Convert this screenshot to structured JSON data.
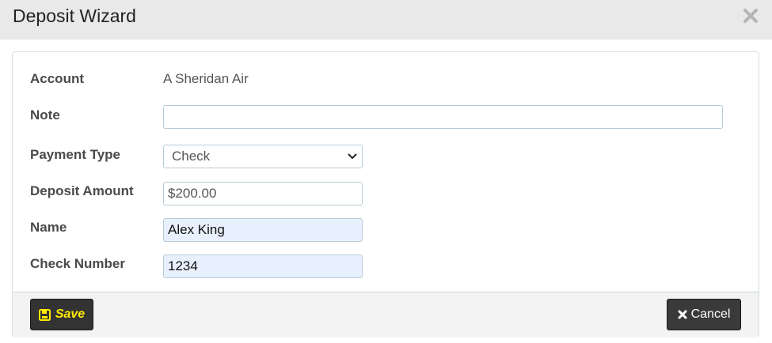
{
  "modal": {
    "title": "Deposit Wizard",
    "close_icon": "close-icon"
  },
  "form": {
    "account_label": "Account",
    "account_value": "A Sheridan Air",
    "note_label": "Note",
    "note_value": "",
    "payment_type_label": "Payment Type",
    "payment_type_value": "Check",
    "deposit_amount_label": "Deposit Amount",
    "deposit_amount_value": "$200.00",
    "name_label": "Name",
    "name_value": "Alex King",
    "check_number_label": "Check Number",
    "check_number_value": "1234"
  },
  "footer": {
    "save_label": "Save",
    "save_icon": "floppy-disk-icon",
    "cancel_label": "Cancel",
    "cancel_icon": "close-icon"
  },
  "colors": {
    "header_bg": "#e9e9e9",
    "save_text": "#ffeb00",
    "button_bg": "#333333",
    "autofill_bg": "#e8f0fe"
  }
}
